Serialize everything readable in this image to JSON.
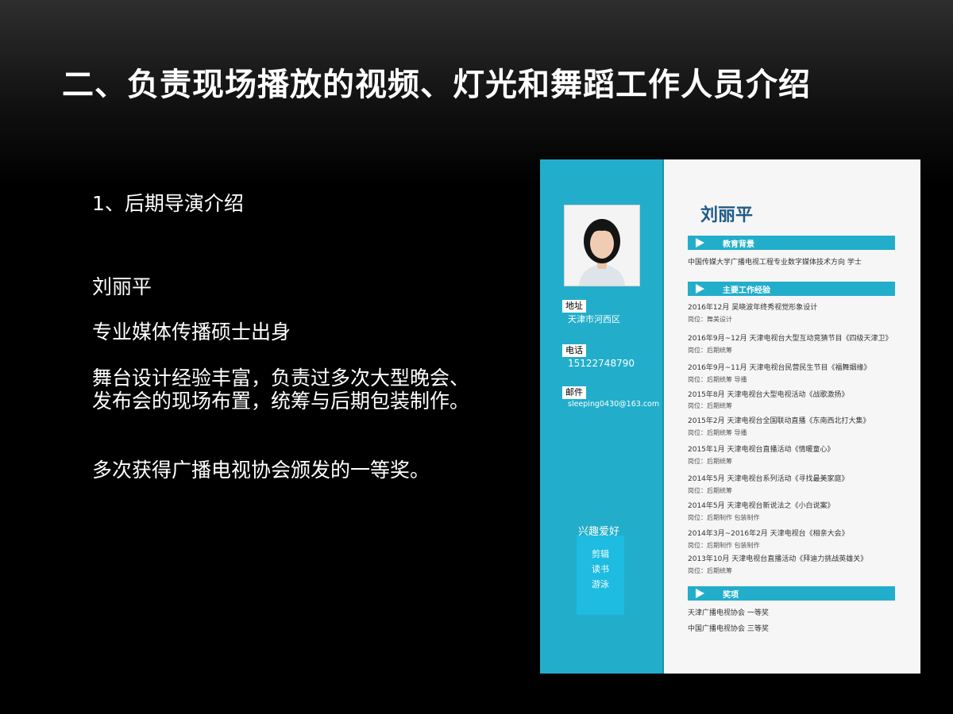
{
  "title": "二、负责现场播放的视频、灯光和舞蹈工作人员介绍",
  "intro": {
    "subtitle": "1、后期导演介绍",
    "name": "刘丽平",
    "degree": "专业媒体传播硕士出身",
    "experience": "舞台设计经验丰富，负责过多次大型晚会、发布会的现场布置，统筹与后期包装制作。",
    "award": "多次获得广播电视协会颁发的一等奖。"
  },
  "resume": {
    "name": "刘丽平",
    "address_label": "地址",
    "address": "天津市河西区",
    "phone_label": "电话",
    "phone": "15122748790",
    "email_label": "邮件",
    "email": "sleeping0430@163.com",
    "hobby_title": "兴趣爱好",
    "hobbies": [
      "剪辑",
      "读书",
      "游泳"
    ],
    "education_title": "教育背景",
    "education": "中国传媒大学广播电视工程专业数字媒体技术方向 学士",
    "work_title": "主要工作经验",
    "work": [
      {
        "line": "2016年12月 吴晓波年终秀视觉形象设计",
        "role": "岗位：舞美设计"
      },
      {
        "line": "2016年9月~12月 天津电视台大型互动竞猜节目《四级天津卫》",
        "role": "岗位：后期统筹"
      },
      {
        "line": "2016年9月~11月 天津电视台民营民生节目《福舞姻缘》",
        "role": "岗位：后期统筹 导播"
      },
      {
        "line": "2015年8月 天津电视台大型电视活动《战歌激扬》",
        "role": "岗位：后期统筹"
      },
      {
        "line": "2015年2月 天津电视台全国联动直播《东南西北打大集》",
        "role": "岗位：后期统筹 导播"
      },
      {
        "line": "2015年1月 天津电视台直播活动《情暖童心》",
        "role": "岗位：后期统筹"
      },
      {
        "line": "2014年5月 天津电视台系列活动《寻找最美家庭》",
        "role": "岗位：后期统筹"
      },
      {
        "line": "2014年5月 天津电视台新说法之《小白说案》",
        "role": "岗位：后期制作 包装制作"
      },
      {
        "line": "2014年3月~2016年2月 天津电视台《相亲大会》",
        "role": "岗位：后期制作 包装制作"
      },
      {
        "line": "2013年10月 天津电视台直播活动《拜迪力挑战英雄关》",
        "role": "岗位：后期统筹"
      }
    ],
    "awards_title": "奖项",
    "awards": [
      "天津广播电视协会 一等奖",
      "中国广播电视协会 三等奖"
    ]
  }
}
